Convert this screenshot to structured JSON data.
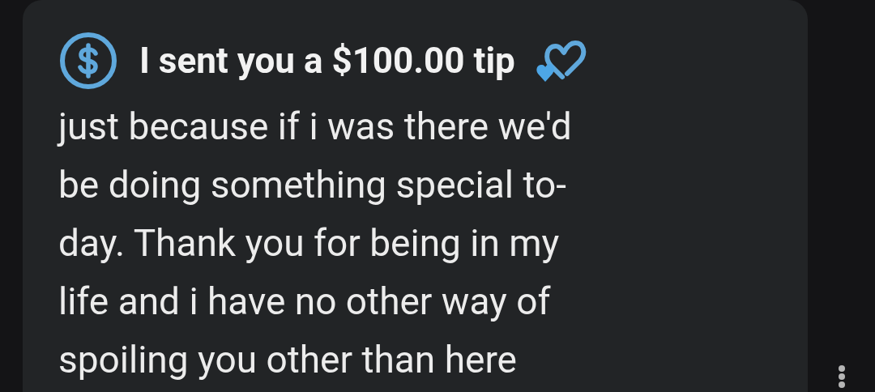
{
  "message": {
    "title": "I sent you a $100.00 tip",
    "body": "just because if i was there we'd\nbe doing something special to-\nday. Thank you for being in my\nlife and i have no other way of\nspoiling you other than here"
  }
}
